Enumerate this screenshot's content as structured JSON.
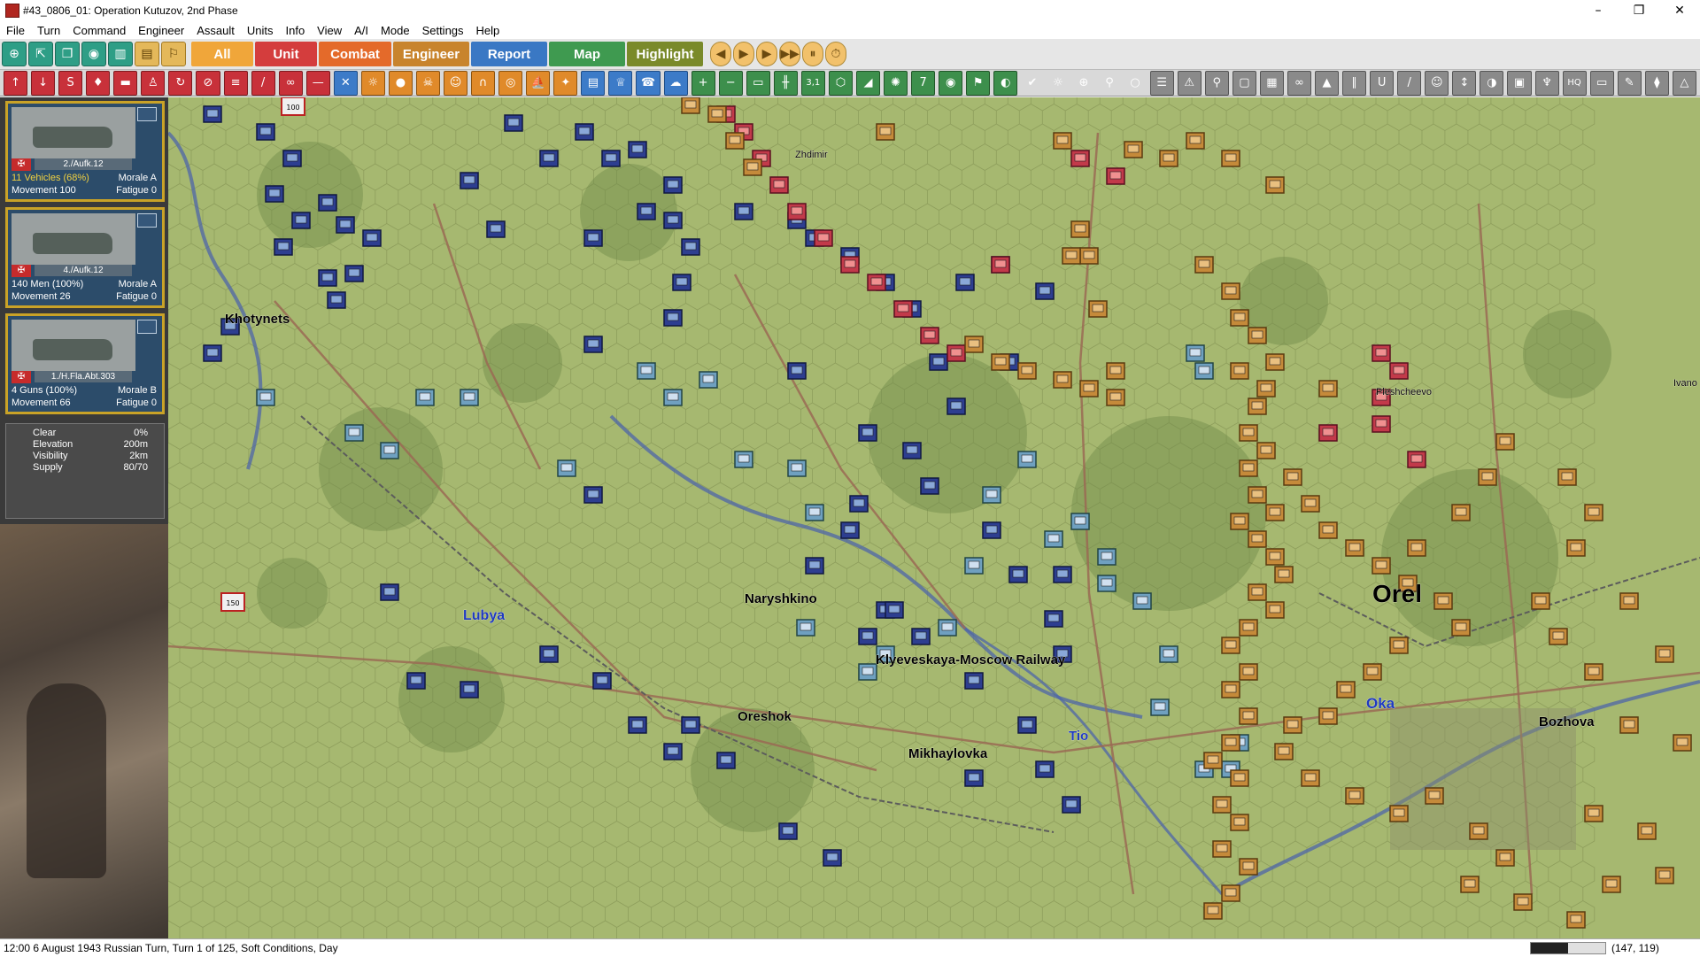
{
  "window": {
    "title": "#43_0806_01: Operation Kutuzov, 2nd Phase",
    "minimize": "–",
    "maximize": "❐",
    "close": "✕"
  },
  "menu": [
    "File",
    "Turn",
    "Command",
    "Engineer",
    "Assault",
    "Units",
    "Info",
    "View",
    "A/I",
    "Mode",
    "Settings",
    "Help"
  ],
  "toolbar": {
    "left_icons": [
      "target-icon",
      "move-icon",
      "copy-icon",
      "eye-icon",
      "book-icon",
      "page-icon",
      "flag-icon"
    ],
    "tabs": [
      {
        "label": "All",
        "color": "#f0a63a"
      },
      {
        "label": "Unit",
        "color": "#d43d3d"
      },
      {
        "label": "Combat",
        "color": "#e46a2a"
      },
      {
        "label": "Engineer",
        "color": "#c8842d"
      },
      {
        "label": "Report",
        "color": "#3a78c4"
      },
      {
        "label": "Map",
        "color": "#3f9a50"
      },
      {
        "label": "Highlight",
        "color": "#7a8a2a"
      }
    ],
    "turn_controls": [
      "◀",
      "▶",
      "▶",
      "▶▶",
      "⏸",
      "⏱"
    ]
  },
  "toolbar2_icons": [
    [
      "up-arrow-icon",
      "red",
      "↑"
    ],
    [
      "down-arrow-icon",
      "red",
      "↓"
    ],
    [
      "supply-icon",
      "red",
      "S"
    ],
    [
      "unit-icon",
      "red",
      "♦"
    ],
    [
      "tank-icon",
      "red",
      "▬"
    ],
    [
      "soldier-icon",
      "red",
      "♙"
    ],
    [
      "cycle-icon",
      "red",
      "↻"
    ],
    [
      "halt-icon",
      "red",
      "⊘"
    ],
    [
      "line-icon",
      "red",
      "≡"
    ],
    [
      "brush-icon",
      "red",
      "/"
    ],
    [
      "binoculars-icon",
      "red",
      "∞"
    ],
    [
      "rifle-icon",
      "red",
      "—"
    ],
    [
      "cross-swords-icon",
      "bl",
      "✕"
    ],
    [
      "artillery-icon",
      "or",
      "☼"
    ],
    [
      "bomb-icon",
      "or",
      "●"
    ],
    [
      "skull-icon",
      "or",
      "☠"
    ],
    [
      "face-icon",
      "or",
      "☺"
    ],
    [
      "bridge-icon",
      "or",
      "∩"
    ],
    [
      "mine-icon",
      "or",
      "◎"
    ],
    [
      "boat-icon",
      "or",
      "⛵"
    ],
    [
      "flame-icon",
      "or",
      "✦"
    ],
    [
      "book-icon",
      "bl",
      "▤"
    ],
    [
      "trophy-icon",
      "bl",
      "♕"
    ],
    [
      "phone-icon",
      "bl",
      "☎"
    ],
    [
      "cloud-icon",
      "bl",
      "☁"
    ],
    [
      "zoom-in-icon",
      "gr",
      "+"
    ],
    [
      "zoom-out-icon",
      "gr",
      "−"
    ],
    [
      "screen-icon",
      "gr",
      "▭"
    ],
    [
      "road-icon",
      "gr",
      "╫"
    ],
    [
      "text-31-icon",
      "gr",
      "3,1"
    ],
    [
      "hex-icon",
      "gr",
      "⬡"
    ],
    [
      "terrain-icon",
      "gr",
      "◢"
    ],
    [
      "star-icon",
      "gr",
      "✺"
    ],
    [
      "seven-icon",
      "gr",
      "7"
    ],
    [
      "circle-icon",
      "gr",
      "◉"
    ],
    [
      "flag-icon",
      "gr",
      "⚑"
    ],
    [
      "half-circle-icon",
      "gr",
      "◐"
    ],
    [
      "yellow-check-icon",
      "gold2",
      "✔"
    ],
    [
      "sun-icon",
      "gold2",
      "☼"
    ],
    [
      "crosshair-icon",
      "gold2",
      "⊕"
    ],
    [
      "pin-icon",
      "gold2",
      "⚲"
    ],
    [
      "ring-icon",
      "gold2",
      "○"
    ],
    [
      "layers-icon",
      "gy",
      "☰"
    ],
    [
      "warning-icon",
      "gy",
      "⚠"
    ],
    [
      "search-icon",
      "gy",
      "⚲"
    ],
    [
      "frame-icon",
      "gy",
      "▢"
    ],
    [
      "grid-icon",
      "gy",
      "▦"
    ],
    [
      "link-icon",
      "gy",
      "∞"
    ],
    [
      "lock-icon",
      "gy",
      "▲"
    ],
    [
      "bars-icon",
      "gy",
      "∥"
    ],
    [
      "u-icon",
      "gy",
      "U"
    ],
    [
      "slash-icon",
      "gy",
      "/"
    ],
    [
      "smile-icon",
      "gy",
      "☺"
    ],
    [
      "temp-icon",
      "gy",
      "↕"
    ],
    [
      "pie-icon",
      "gy",
      "◑"
    ],
    [
      "box-icon",
      "gy",
      "▣"
    ],
    [
      "eagle-icon",
      "gy",
      "♆"
    ],
    [
      "hq-icon",
      "gy",
      "HQ"
    ],
    [
      "card-icon",
      "gy",
      "▭"
    ],
    [
      "pencil-icon",
      "gy",
      "✎"
    ],
    [
      "tree-icon",
      "gy",
      "⧫"
    ],
    [
      "triangle-icon",
      "gy",
      "△"
    ]
  ],
  "units": [
    {
      "name": "2./Aufk.12",
      "strength": "11 Vehicles (68%)",
      "strength_color": "#f0d040",
      "morale": "Morale A",
      "movement": "Movement 100",
      "fatigue": "Fatigue 0"
    },
    {
      "name": "4./Aufk.12",
      "strength": "140 Men (100%)",
      "strength_color": "#ffffff",
      "morale": "Morale A",
      "movement": "Movement 26",
      "fatigue": "Fatigue 0"
    },
    {
      "name": "1./H.Fla.Abt.303",
      "strength": "4 Guns (100%)",
      "strength_color": "#ffffff",
      "morale": "Morale B",
      "movement": "Movement 66",
      "fatigue": "Fatigue 0"
    }
  ],
  "terrain": [
    {
      "label": "Clear",
      "value": "0%"
    },
    {
      "label": "Elevation",
      "value": "200m"
    },
    {
      "label": "Visibility",
      "value": "2km"
    },
    {
      "label": "Supply",
      "value": "80/70"
    }
  ],
  "map": {
    "colors": {
      "grass": "#a6b870",
      "hexline": "#8e9e5c",
      "forest": "#6f8a4a",
      "road": "#9a6a54",
      "rail": "#5c5c5c",
      "river": "#4d66a8",
      "german": "#2d3e90",
      "german_light": "#6fa0c0",
      "soviet": "#c58a3a",
      "soviet_red": "#c23a4a"
    },
    "place_labels": [
      {
        "text": "Khotynets",
        "color": "#000000",
        "size": 15,
        "bold": true
      },
      {
        "text": "Zhdimir",
        "color": "#000000",
        "size": 11,
        "bold": false
      },
      {
        "text": "Naryshkino",
        "color": "#000000",
        "size": 15,
        "bold": true
      },
      {
        "text": "Lubya",
        "color": "#1f3ac0",
        "size": 16,
        "bold": true
      },
      {
        "text": "Klyeveskaya-Moscow Railway",
        "color": "#000000",
        "size": 15,
        "bold": true
      },
      {
        "text": "Oreshok",
        "color": "#000000",
        "size": 15,
        "bold": true
      },
      {
        "text": "Mikhaylovka",
        "color": "#000000",
        "size": 15,
        "bold": true
      },
      {
        "text": "Tio",
        "color": "#1f3ac0",
        "size": 15,
        "bold": true
      },
      {
        "text": "Orel",
        "color": "#000000",
        "size": 28,
        "bold": true
      },
      {
        "text": "Oka",
        "color": "#1f3ac0",
        "size": 17,
        "bold": true
      },
      {
        "text": "Bozhova",
        "color": "#000000",
        "size": 15,
        "bold": true
      },
      {
        "text": "Pleshcheevo",
        "color": "#000000",
        "size": 11,
        "bold": false
      },
      {
        "text": "Ivano",
        "color": "#000000",
        "size": 11,
        "bold": false
      }
    ],
    "counter_values": [
      "100",
      "150"
    ]
  },
  "status": {
    "text": "12:00 6 August 1943 Russian Turn, Turn 1 of 125, Soft Conditions, Day",
    "progress": 0.5,
    "coords": "(147, 119)"
  }
}
